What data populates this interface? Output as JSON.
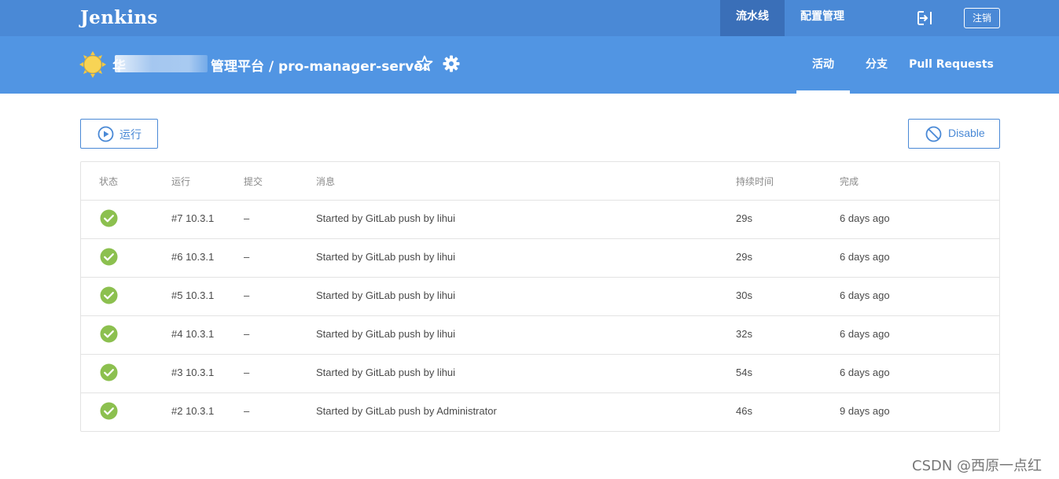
{
  "topbar": {
    "logo": "Jenkins",
    "nav": [
      "流水线",
      "配置管理"
    ],
    "logout_label": "注销"
  },
  "header": {
    "project_prefix": "华",
    "project_title": "管理平台 / pro-manager-server",
    "tabs": [
      "活动",
      "分支",
      "Pull Requests"
    ]
  },
  "actions": {
    "run_label": "运行",
    "disable_label": "Disable"
  },
  "table": {
    "columns": [
      "状态",
      "运行",
      "提交",
      "消息",
      "持续时间",
      "完成"
    ],
    "rows": [
      {
        "run": "#7 10.3.1",
        "commit": "–",
        "message": "Started by GitLab push by lihui",
        "duration": "29s",
        "completed": "6 days ago"
      },
      {
        "run": "#6 10.3.1",
        "commit": "–",
        "message": "Started by GitLab push by lihui",
        "duration": "29s",
        "completed": "6 days ago"
      },
      {
        "run": "#5 10.3.1",
        "commit": "–",
        "message": "Started by GitLab push by lihui",
        "duration": "30s",
        "completed": "6 days ago"
      },
      {
        "run": "#4 10.3.1",
        "commit": "–",
        "message": "Started by GitLab push by lihui",
        "duration": "32s",
        "completed": "6 days ago"
      },
      {
        "run": "#3 10.3.1",
        "commit": "–",
        "message": "Started by GitLab push by lihui",
        "duration": "54s",
        "completed": "6 days ago"
      },
      {
        "run": "#2 10.3.1",
        "commit": "–",
        "message": "Started by GitLab push by Administrator",
        "duration": "46s",
        "completed": "9 days ago"
      }
    ]
  },
  "watermark": "CSDN @西原一点红",
  "colors": {
    "topbar": "#4a89d6",
    "subbar": "#5195e3",
    "success": "#8cc04f",
    "accent": "#4a89d6"
  },
  "icons": {
    "status": "check-circle-icon",
    "run": "play-circle-icon",
    "disable": "ban-icon",
    "favorite": "star-outline-icon",
    "settings": "gear-icon",
    "logout": "sign-out-icon",
    "health": "sun-weather-icon"
  }
}
